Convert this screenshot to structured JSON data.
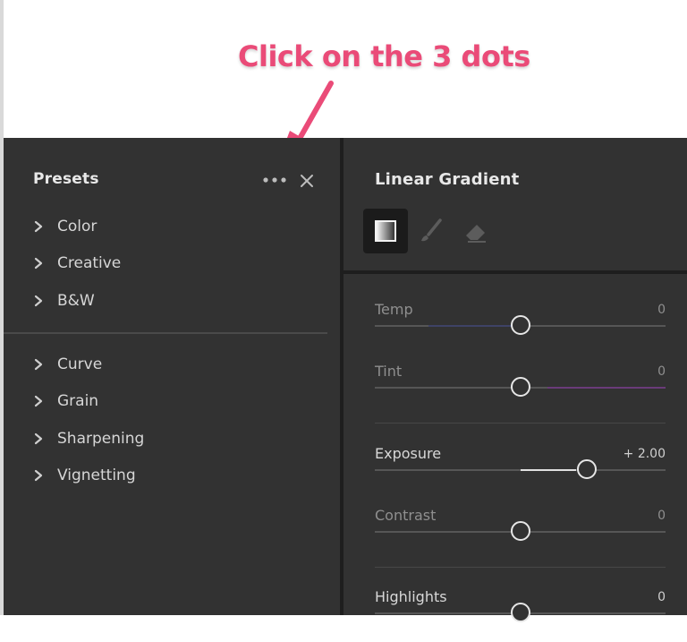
{
  "annotation": {
    "text": "Click on the 3 dots",
    "color": "#ea4b78"
  },
  "presets_panel": {
    "title": "Presets",
    "more_icon": "more-horizontal-icon",
    "close_icon": "close-icon",
    "groups": [
      {
        "items": [
          {
            "label": "Color"
          },
          {
            "label": "Creative"
          },
          {
            "label": "B&W"
          }
        ]
      },
      {
        "items": [
          {
            "label": "Curve"
          },
          {
            "label": "Grain"
          },
          {
            "label": "Sharpening"
          },
          {
            "label": "Vignetting"
          }
        ]
      }
    ]
  },
  "mask_panel": {
    "title": "Linear Gradient",
    "tools": [
      {
        "name": "linear-gradient-tool",
        "icon": "gradient-square-icon",
        "active": true
      },
      {
        "name": "brush-tool",
        "icon": "brush-icon",
        "active": false
      },
      {
        "name": "eraser-tool",
        "icon": "eraser-icon",
        "active": false
      }
    ],
    "sliders": [
      {
        "label": "Temp",
        "value": "0",
        "position": 0.5,
        "style": "temp"
      },
      {
        "label": "Tint",
        "value": "0",
        "position": 0.5,
        "style": "tint"
      },
      {
        "label": "Exposure",
        "value": "+ 2.00",
        "position": 0.73,
        "style": "exposure"
      },
      {
        "label": "Contrast",
        "value": "0",
        "position": 0.5,
        "style": "plain"
      },
      {
        "label": "Highlights",
        "value": "0",
        "position": 0.5,
        "style": "plain"
      }
    ]
  },
  "colors": {
    "panel_bg": "#323232",
    "tint_accent": "#6a3b79",
    "temp_accent": "#3e4266"
  }
}
